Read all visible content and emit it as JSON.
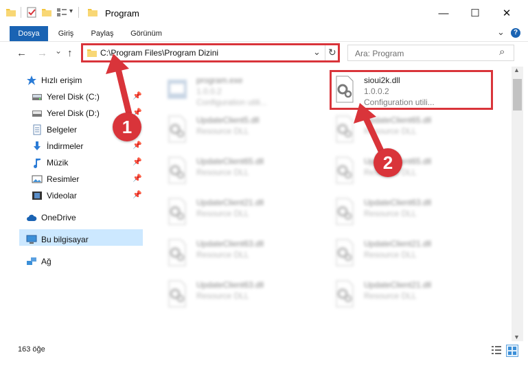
{
  "window": {
    "title": "Program",
    "controls": {
      "minimize": "—",
      "maximize": "☐",
      "close": "✕"
    }
  },
  "ribbon": {
    "tabs": [
      "Dosya",
      "Giriş",
      "Paylaş",
      "Görünüm"
    ],
    "collapse_icon": "⌄",
    "help_icon": "?"
  },
  "nav": {
    "back": "←",
    "forward": "→",
    "recent": "⌄",
    "up": "↑",
    "address": "C:\\Program Files\\Program Dizini",
    "dropdown": "⌄",
    "refresh": "↻",
    "search_placeholder": "Ara: Program",
    "search_icon": "⌕"
  },
  "sidebar": {
    "items": [
      {
        "label": "Hızlı erişim",
        "icon": "star-icon"
      },
      {
        "label": "Yerel Disk (C:)",
        "icon": "drive-icon",
        "pinned": true
      },
      {
        "label": "Yerel Disk (D:)",
        "icon": "drive-icon",
        "pinned": true
      },
      {
        "label": "Belgeler",
        "icon": "document-icon",
        "pinned": true
      },
      {
        "label": "İndirmeler",
        "icon": "download-icon",
        "pinned": true
      },
      {
        "label": "Müzik",
        "icon": "music-icon",
        "pinned": true
      },
      {
        "label": "Resimler",
        "icon": "pictures-icon",
        "pinned": true
      },
      {
        "label": "Videolar",
        "icon": "video-icon",
        "pinned": true
      },
      {
        "label": "OneDrive",
        "icon": "cloud-icon"
      },
      {
        "label": "Bu bilgisayar",
        "icon": "computer-icon",
        "selected": true
      },
      {
        "label": "Ağ",
        "icon": "network-icon"
      }
    ]
  },
  "files": {
    "left": [
      {
        "name": "program.exe",
        "l2": "1.0.0.2",
        "l3": "Configuration utili..."
      },
      {
        "name": "UpdateClient5.dll",
        "l2": "Resource DLL"
      },
      {
        "name": "UpdateClient65.dll",
        "l2": "Resource DLL"
      },
      {
        "name": "UpdateClient21.dll",
        "l2": "Resource DLL"
      },
      {
        "name": "UpdateClient63.dll",
        "l2": "Resource DLL"
      },
      {
        "name": "UpdateClient63.dll",
        "l2": "Resource DLL"
      }
    ],
    "right": [
      {
        "name": "sioui2k.dll",
        "l2": "1.0.0.2",
        "l3": "Configuration utili..."
      },
      {
        "name": "UpdateClient65.dll",
        "l2": "Resource DLL"
      },
      {
        "name": "UpdateClient65.dll",
        "l2": "Resource DLL"
      },
      {
        "name": "UpdateClient63.dll",
        "l2": "Resource DLL"
      },
      {
        "name": "UpdateClient21.dll",
        "l2": "Resource DLL"
      },
      {
        "name": "UpdateClient21.dll",
        "l2": "Resource DLL"
      }
    ]
  },
  "status": {
    "count": "163 öğe"
  },
  "annotations": {
    "badge1": "1",
    "badge2": "2"
  },
  "colors": {
    "accent": "#1a63b3",
    "annotation_red": "#d9343a",
    "selection": "#cce8ff"
  }
}
